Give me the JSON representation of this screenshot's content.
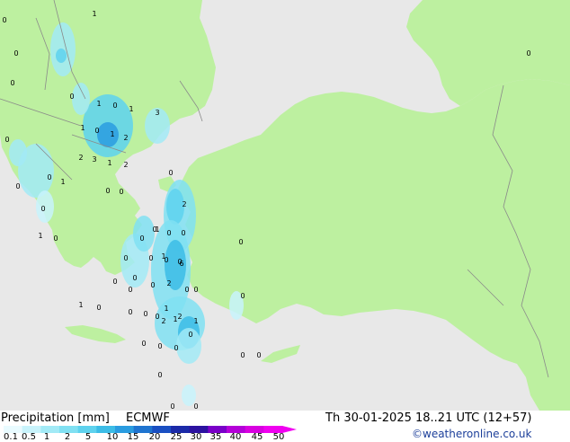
{
  "legend": {
    "title": "Precipitation [mm]",
    "model": "ECMWF",
    "datetime": "Th 30-01-2025 18..21 UTC (12+57)",
    "credit": "©weatheronline.co.uk",
    "ticks": [
      "0.1",
      "0.5",
      "1",
      "2",
      "5",
      "10",
      "15",
      "20",
      "25",
      "30",
      "35",
      "40",
      "45",
      "50"
    ],
    "colors": [
      "#e9fbff",
      "#c8f3fb",
      "#a2eaf6",
      "#80e0f2",
      "#5ed2ee",
      "#3cbce6",
      "#2a9ce0",
      "#1f74d0",
      "#1a4fc2",
      "#1b2aa8",
      "#2c12a0",
      "#7a00c8",
      "#b400d8",
      "#d800e0",
      "#f000f0"
    ]
  },
  "map": {
    "colors": {
      "land": "#bdf0a0",
      "sea": "#e8e8e8",
      "border": "#8a8a8a"
    },
    "labels": [
      "0",
      "1",
      "0",
      "0",
      "0",
      "0",
      "1",
      "0",
      "1",
      "3",
      "0",
      "1",
      "0",
      "1",
      "2",
      "3",
      "1",
      "2",
      "2",
      "0",
      "0",
      "1",
      "0",
      "0",
      "0",
      "2",
      "0",
      "1",
      "0",
      "0",
      "0",
      "0",
      "0",
      "1",
      "0",
      "0",
      "1",
      "0",
      "0",
      "0",
      "6",
      "0",
      "0",
      "2",
      "0",
      "0",
      "0",
      "0",
      "1",
      "2",
      "1",
      "2",
      "1",
      "0",
      "1",
      "0",
      "0",
      "0",
      "0",
      "0",
      "0",
      "0",
      "0",
      "0",
      "0",
      "0",
      "0",
      "0"
    ]
  }
}
